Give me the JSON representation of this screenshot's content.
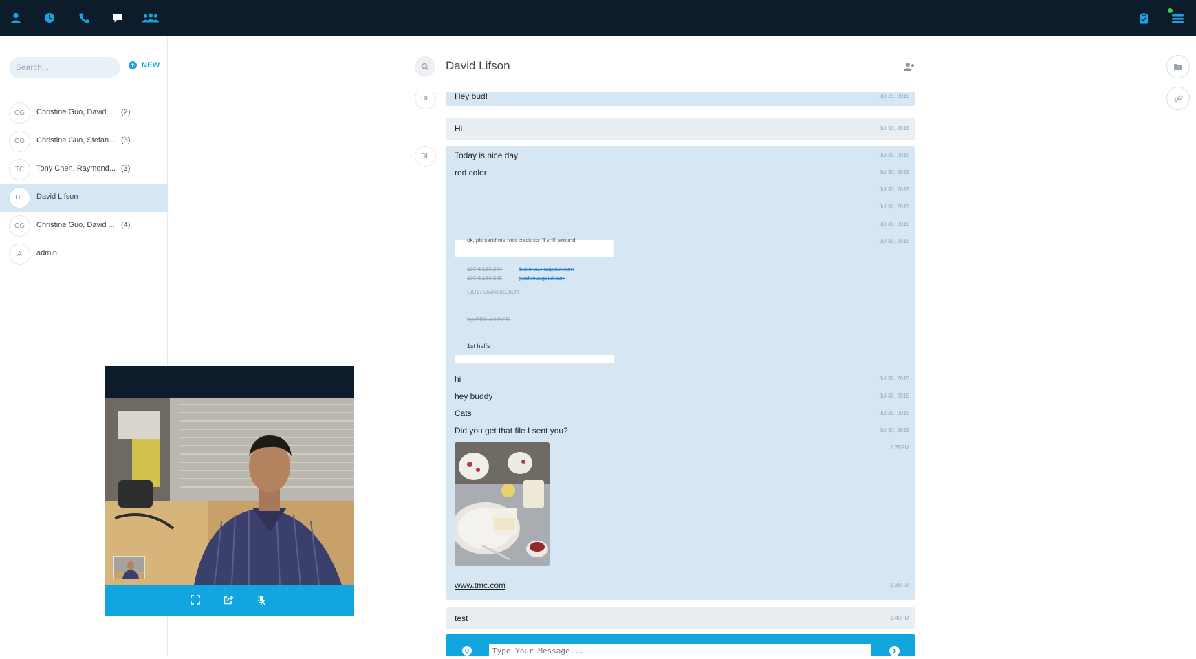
{
  "nav": {
    "items": [
      {
        "name": "contacts",
        "icon": "person-icon"
      },
      {
        "name": "history",
        "icon": "clock-icon"
      },
      {
        "name": "calls",
        "icon": "phone-icon"
      },
      {
        "name": "chat",
        "icon": "chat-bubble-icon",
        "active": true
      },
      {
        "name": "groups",
        "icon": "group-icon"
      }
    ],
    "right_icons": [
      "clipboard-icon",
      "menu-icon"
    ],
    "status_color": "#3ecf4a",
    "accent": "#1aa3e0",
    "bar_color": "#0c1c2b"
  },
  "sidebar": {
    "search_placeholder": "Search...",
    "new_label": "NEW",
    "contacts": [
      {
        "initials": "CG",
        "name": "Christine Guo, David ...",
        "count": "(2)"
      },
      {
        "initials": "CG",
        "name": "Christine Guo, Stefan...",
        "count": "(3)"
      },
      {
        "initials": "TC",
        "name": "Tony Chen, Raymond...",
        "count": "(3)"
      },
      {
        "initials": "DL",
        "name": "David Lifson",
        "count": "",
        "active": true
      },
      {
        "initials": "CG",
        "name": "Christine Guo, David ...",
        "count": "(4)"
      },
      {
        "initials": "A",
        "name": "admin",
        "count": ""
      }
    ]
  },
  "chat": {
    "title": "David Lifson",
    "messages": {
      "m1": {
        "avatar": "DL",
        "text": "Hey bud!",
        "time": "Jul 29, 2015"
      },
      "m2": {
        "text": "Hi",
        "time": "Jul 30, 2015"
      },
      "group": {
        "avatar": "DL",
        "lines": [
          {
            "text": "Today is nice day",
            "time": "Jul 30, 2015"
          },
          {
            "text": "red color",
            "time": "Jul 30, 2015"
          },
          {
            "text": "",
            "time": "Jul 30, 2015"
          },
          {
            "text": "",
            "time": "Jul 30, 2015"
          },
          {
            "text": "",
            "time": "Jul 30, 2015"
          },
          {
            "text": "",
            "time": "Jul 30, 2015"
          }
        ],
        "snippet": {
          "header": "ok, pls send me root creds so i'll shift around",
          "ip1": "107.6.180.244",
          "host1": "bettervu.nuagetel.com",
          "ip2": "107.6.180.245",
          "host2": "jtech.nuagetel.com",
          "code1": "UiU17uJw0akSCbO9",
          "code2": "hgvBI8htashHOM",
          "note": "1st halfs"
        },
        "lines2": [
          {
            "text": "hi",
            "time": "Jul 30, 2015"
          },
          {
            "text": "hey buddy",
            "time": "Jul 30, 2015"
          },
          {
            "text": "Cats",
            "time": "Jul 30, 2015"
          },
          {
            "text": "Did you get that file I sent you?",
            "time": "Jul 30, 2015"
          }
        ],
        "image_time": "1:35PM",
        "link": {
          "text": "www.tmc.com",
          "time": "1:38PM"
        }
      },
      "m3": {
        "text": "test",
        "time": "1:40PM"
      }
    },
    "composer_placeholder": "Type Your Message..."
  },
  "right_tools": [
    "folder-icon",
    "link-icon"
  ],
  "video": {
    "controls": [
      "fullscreen-icon",
      "share-icon",
      "mute-mic-icon"
    ]
  }
}
